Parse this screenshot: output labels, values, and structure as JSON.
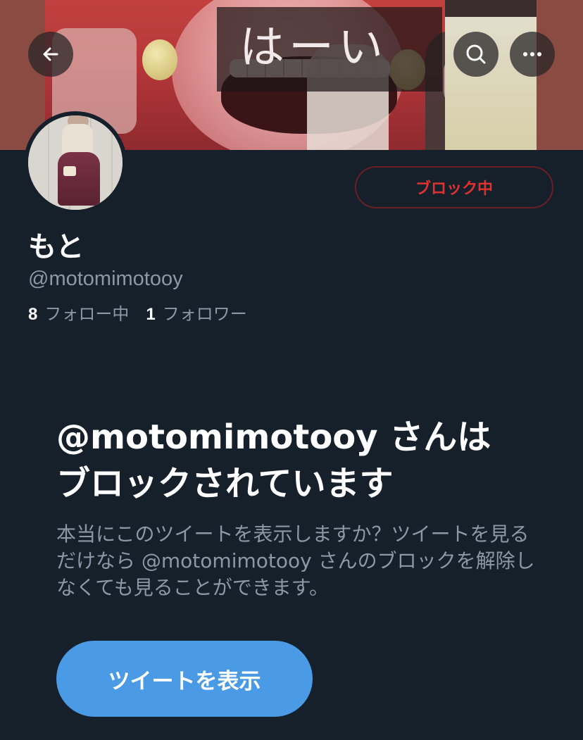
{
  "colors": {
    "background": "#15202b",
    "text_primary": "#ffffff",
    "text_secondary": "#8b98a5",
    "block_red": "#e0332f",
    "block_border": "#6b1e24",
    "button_blue": "#4a9ae6"
  },
  "header": {
    "banner_sign_text": "はーい",
    "back_icon": "arrow-left-icon",
    "search_icon": "search-icon",
    "more_icon": "more-horizontal-icon"
  },
  "profile": {
    "display_name": "もと",
    "handle": "@motomimotooy",
    "following_count": "8",
    "following_label": "フォロー中",
    "followers_count": "1",
    "followers_label": "フォロワー",
    "block_button_label": "ブロック中"
  },
  "blocked_notice": {
    "title": "@motomimotooy さんはブロックされています",
    "description": "本当にこのツイートを表示しますか？ツイートを見るだけなら @motomimotooy さんのブロックを解除しなくても見ることができます。",
    "view_button_label": "ツイートを表示"
  }
}
